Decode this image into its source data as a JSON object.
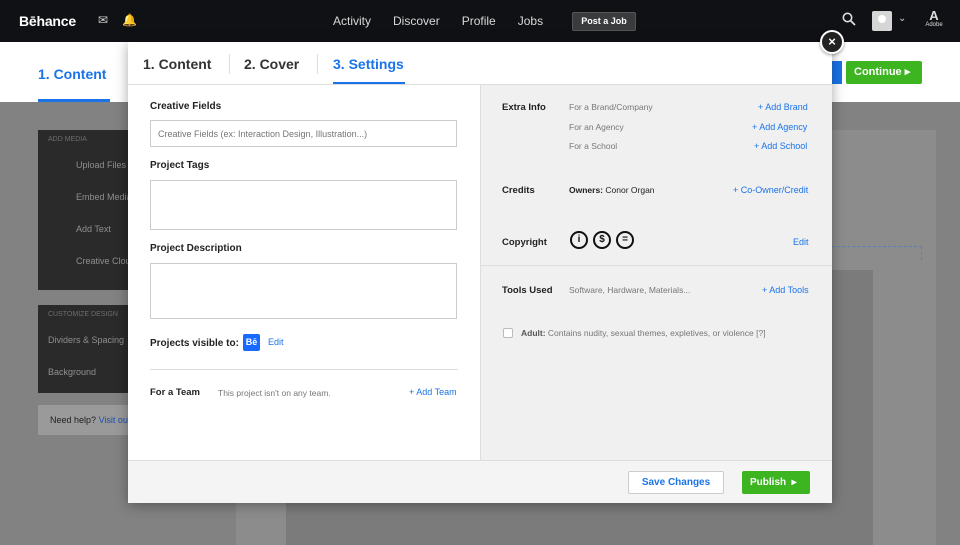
{
  "topbar": {
    "logo": "Bēhance",
    "nav": [
      "Activity",
      "Discover",
      "Profile",
      "Jobs"
    ],
    "post_job": "Post a Job",
    "adobe_label": "Adobe",
    "adobe_glyph": "A"
  },
  "background": {
    "tab": "1.  Content",
    "continue": "Continue",
    "add_media_header": "ADD MEDIA",
    "add_media_items": [
      "Upload Files",
      "Embed Media",
      "Add Text",
      "Creative Cloud"
    ],
    "customize_header": "CUSTOMIZE DESIGN",
    "customize_items": [
      "Dividers & Spacing",
      "Background"
    ],
    "help_text": "Need help?",
    "help_link": "Visit our"
  },
  "modal": {
    "close": "×",
    "tabs": [
      {
        "label": "1.  Content"
      },
      {
        "label": "2.  Cover"
      },
      {
        "label": "3.  Settings"
      }
    ],
    "left": {
      "creative_fields_label": "Creative Fields",
      "creative_fields_placeholder": "Creative Fields (ex: Interaction Design, Illustration...)",
      "project_tags_label": "Project Tags",
      "project_description_label": "Project Description",
      "visible_label": "Projects visible to:",
      "visible_badge": "Bē",
      "visible_edit": "Edit",
      "team_label": "For a Team",
      "team_text": "This project isn't on any team.",
      "team_link": "+ Add Team"
    },
    "right": {
      "extra_info_label": "Extra Info",
      "extra_info_rows": [
        {
          "text": "For a Brand/Company",
          "link": "+ Add Brand"
        },
        {
          "text": "For an Agency",
          "link": "+ Add Agency"
        },
        {
          "text": "For a School",
          "link": "+ Add School"
        }
      ],
      "credits_label": "Credits",
      "owners_label": "Owners:",
      "owners_value": "Conor Organ",
      "credits_link": "+ Co-Owner/Credit",
      "copyright_label": "Copyright",
      "copyright_icons": [
        "i",
        "$",
        "="
      ],
      "copyright_edit": "Edit",
      "tools_label": "Tools Used",
      "tools_placeholder": "Software, Hardware, Materials...",
      "tools_link": "+ Add Tools",
      "adult_label": "Adult:",
      "adult_text": "Contains nudity, sexual themes, expletives, or violence [?]"
    },
    "footer": {
      "save": "Save Changes",
      "publish": "Publish"
    }
  }
}
